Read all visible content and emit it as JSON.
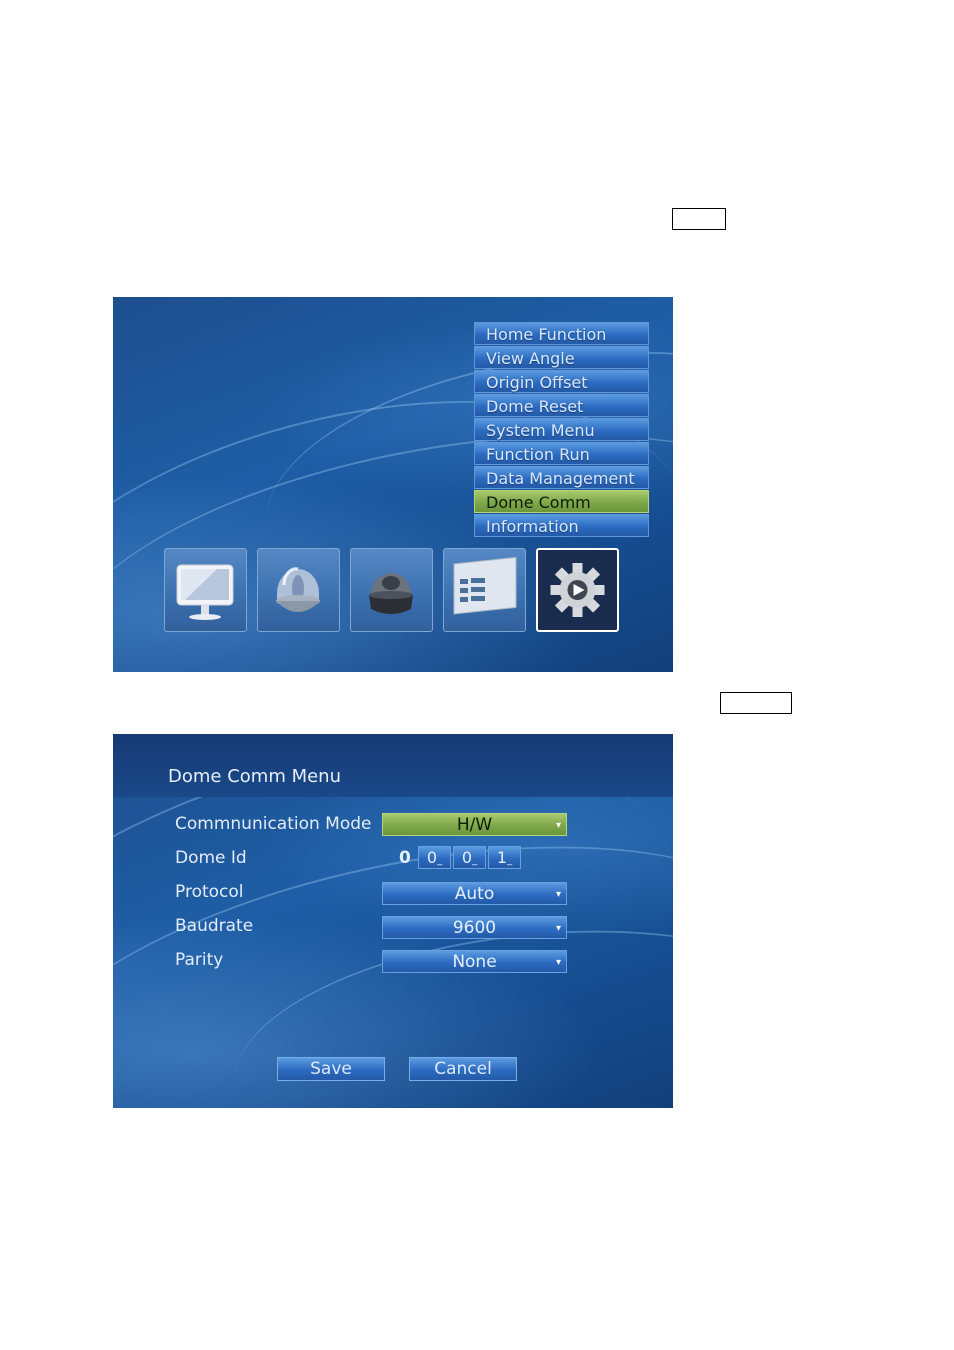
{
  "main_menu": {
    "items": [
      {
        "label": "Home Function"
      },
      {
        "label": "View Angle"
      },
      {
        "label": "Origin Offset"
      },
      {
        "label": "Dome Reset"
      },
      {
        "label": "System Menu"
      },
      {
        "label": "Function Run"
      },
      {
        "label": "Data Management"
      },
      {
        "label": "Dome Comm",
        "selected": true
      },
      {
        "label": "Information"
      }
    ],
    "tiles": [
      {
        "icon": "monitor-icon"
      },
      {
        "icon": "clear-dome-camera-icon"
      },
      {
        "icon": "dark-dome-camera-icon"
      },
      {
        "icon": "window-list-icon"
      },
      {
        "icon": "gear-icon",
        "active": true
      }
    ]
  },
  "dome_comm": {
    "title": "Dome Comm Menu",
    "fields": {
      "comm_mode": {
        "label": "Commnunication Mode",
        "value": "H/W"
      },
      "dome_id": {
        "label": "Dome Id",
        "fixed_digit": "0",
        "digits": [
          "0",
          "0",
          "1"
        ]
      },
      "protocol": {
        "label": "Protocol",
        "value": "Auto"
      },
      "baudrate": {
        "label": "Baudrate",
        "value": "9600"
      },
      "parity": {
        "label": "Parity",
        "value": "None"
      }
    },
    "buttons": {
      "save": "Save",
      "cancel": "Cancel"
    }
  },
  "colors": {
    "selected": "#7ea84a",
    "menu_blue": "#2c6bc0",
    "background": "#1a4f90"
  }
}
